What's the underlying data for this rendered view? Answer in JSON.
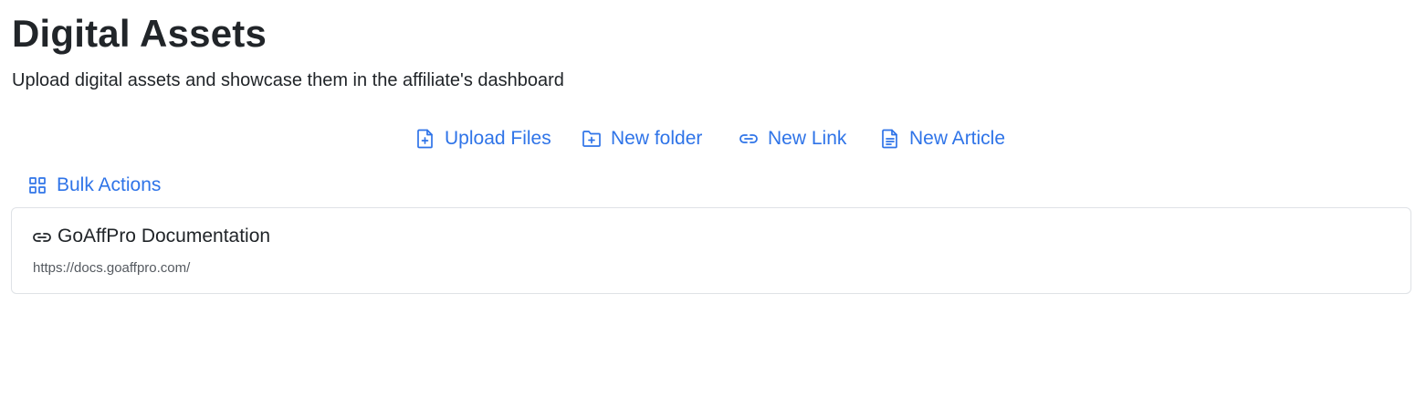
{
  "header": {
    "title": "Digital Assets",
    "subtitle": "Upload digital assets and showcase them in the affiliate's dashboard"
  },
  "actions": {
    "upload_files": {
      "label": "Upload Files",
      "icon": "file-plus-icon"
    },
    "new_folder": {
      "label": "New folder",
      "icon": "folder-plus-icon"
    },
    "new_link": {
      "label": "New Link",
      "icon": "link-icon"
    },
    "new_article": {
      "label": "New Article",
      "icon": "file-text-icon"
    }
  },
  "bulk_actions": {
    "label": "Bulk Actions",
    "icon": "grid-icon"
  },
  "assets": [
    {
      "type": "link",
      "icon": "link-icon",
      "title": "GoAffPro Documentation",
      "url": "https://docs.goaffpro.com/"
    }
  ],
  "colors": {
    "accent": "#2f74e8",
    "text": "#212529",
    "muted": "#555a60",
    "border": "#dfe2e6"
  }
}
